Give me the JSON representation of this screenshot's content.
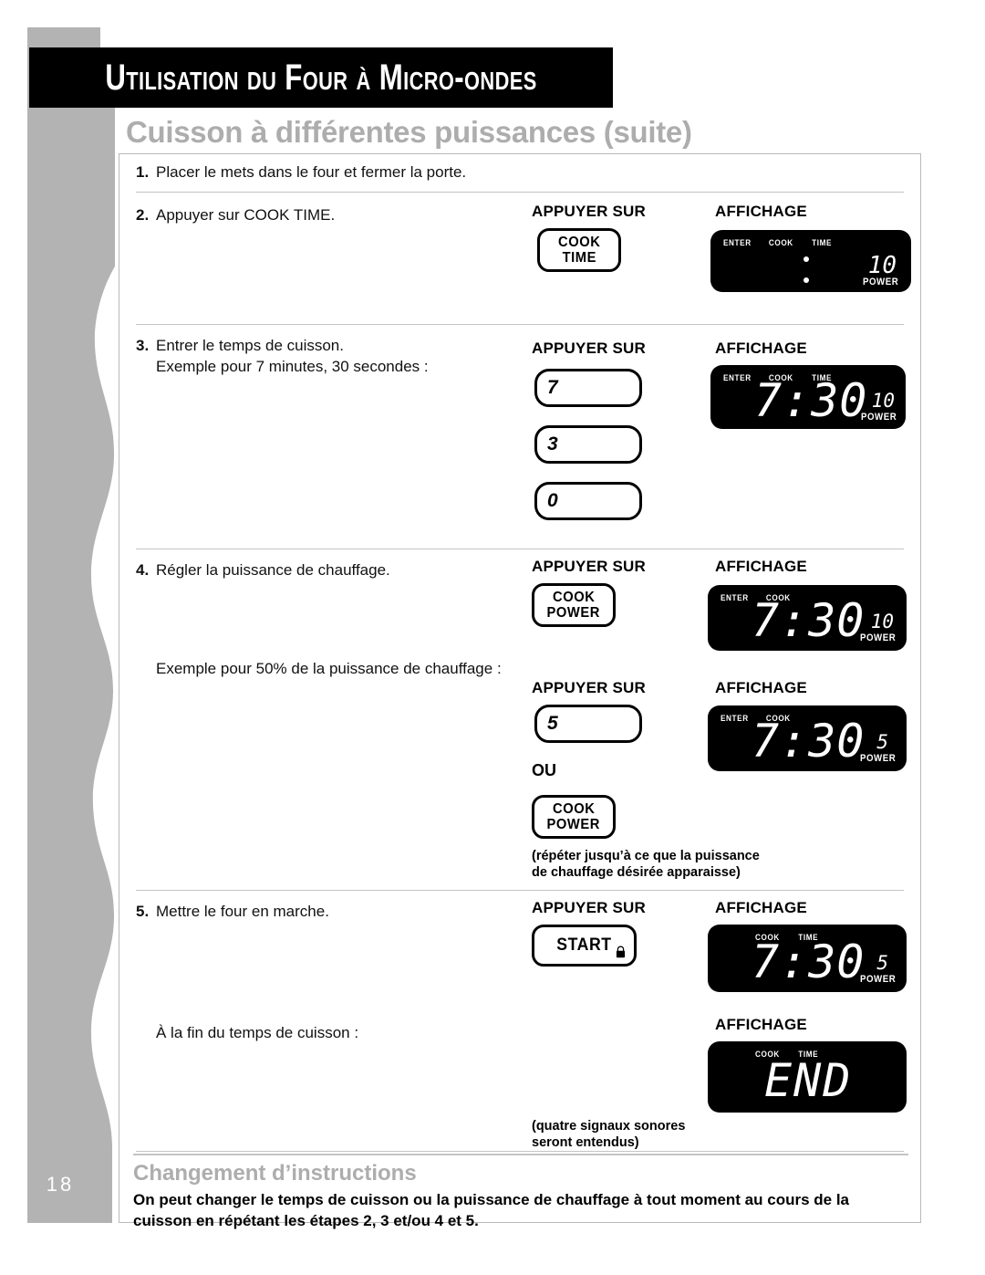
{
  "page": {
    "number": "18",
    "header_title": "Utilisation du Four à Micro-ondes",
    "subtitle": "Cuisson à différentes puissances (suite)"
  },
  "labels": {
    "press": "APPUYER SUR",
    "display": "AFFICHAGE",
    "or": "OU"
  },
  "steps": [
    {
      "num": "1.",
      "line1": "Placer le mets dans le four et fermer la porte.",
      "line2": ""
    },
    {
      "num": "2.",
      "line1": "Appuyer sur COOK TIME.",
      "line2": ""
    },
    {
      "num": "3.",
      "line1": "Entrer le temps de cuisson.",
      "line2": "Exemple pour 7 minutes, 30 secondes :"
    },
    {
      "num": "4.",
      "line1": "Régler la puissance de chauffage.",
      "line2": ""
    },
    {
      "num": "5.",
      "line1": "Mettre le four en marche.",
      "line2": ""
    }
  ],
  "extra_text": {
    "example_50": "Exemple pour 50% de la puissance de chauffage :",
    "end_of_time": "À la fin du temps de cuisson :"
  },
  "buttons": {
    "cook_time_l1": "COOK",
    "cook_time_l2": "TIME",
    "cook_power_l1": "COOK",
    "cook_power_l2": "POWER",
    "start": "START",
    "seven": "7",
    "three": "3",
    "zero": "0",
    "five": "5"
  },
  "notes": {
    "repeat_l1": "(répéter jusqu’à ce que la puissance",
    "repeat_l2": "de chauffage désirée apparaisse)",
    "beeps_l1": "(quatre signaux sonores",
    "beeps_l2": "seront entendus)"
  },
  "displays": [
    {
      "id": "display-step2",
      "indicators": [
        "ENTER",
        "COOK",
        "TIME"
      ],
      "time": "",
      "power": "10",
      "power_word": "POWER",
      "colon_only": true
    },
    {
      "id": "display-step3",
      "indicators": [
        "ENTER",
        "COOK",
        "TIME"
      ],
      "time": "7:30",
      "power": "10",
      "power_word": "POWER",
      "colon_only": false
    },
    {
      "id": "display-step4",
      "indicators": [
        "ENTER",
        "COOK"
      ],
      "time": "7:30",
      "power": "10",
      "power_word": "POWER",
      "colon_only": false
    },
    {
      "id": "display-step4b",
      "indicators": [
        "ENTER",
        "COOK"
      ],
      "time": "7:30",
      "power": "5",
      "power_word": "POWER",
      "colon_only": false
    },
    {
      "id": "display-step5",
      "indicators": [
        "COOK",
        "TIME"
      ],
      "time": "7:30",
      "power": "5",
      "power_word": "POWER",
      "colon_only": false
    },
    {
      "id": "display-end",
      "indicators": [
        "COOK",
        "TIME"
      ],
      "time": "END",
      "power": "",
      "power_word": "",
      "colon_only": false
    }
  ],
  "footer": {
    "heading": "Changement d’instructions",
    "body_l1": "On peut changer le temps de cuisson ou la puissance de chauffage à tout moment au cours de la",
    "body_l2": "cuisson en répétant les étapes 2, 3 et/ou 4 et 5."
  },
  "colors": {
    "gray_strip": "#b3b3b3",
    "subtitle_gray": "#adadad",
    "rule": "#c4c4c4",
    "lcd_bg": "#000000"
  }
}
